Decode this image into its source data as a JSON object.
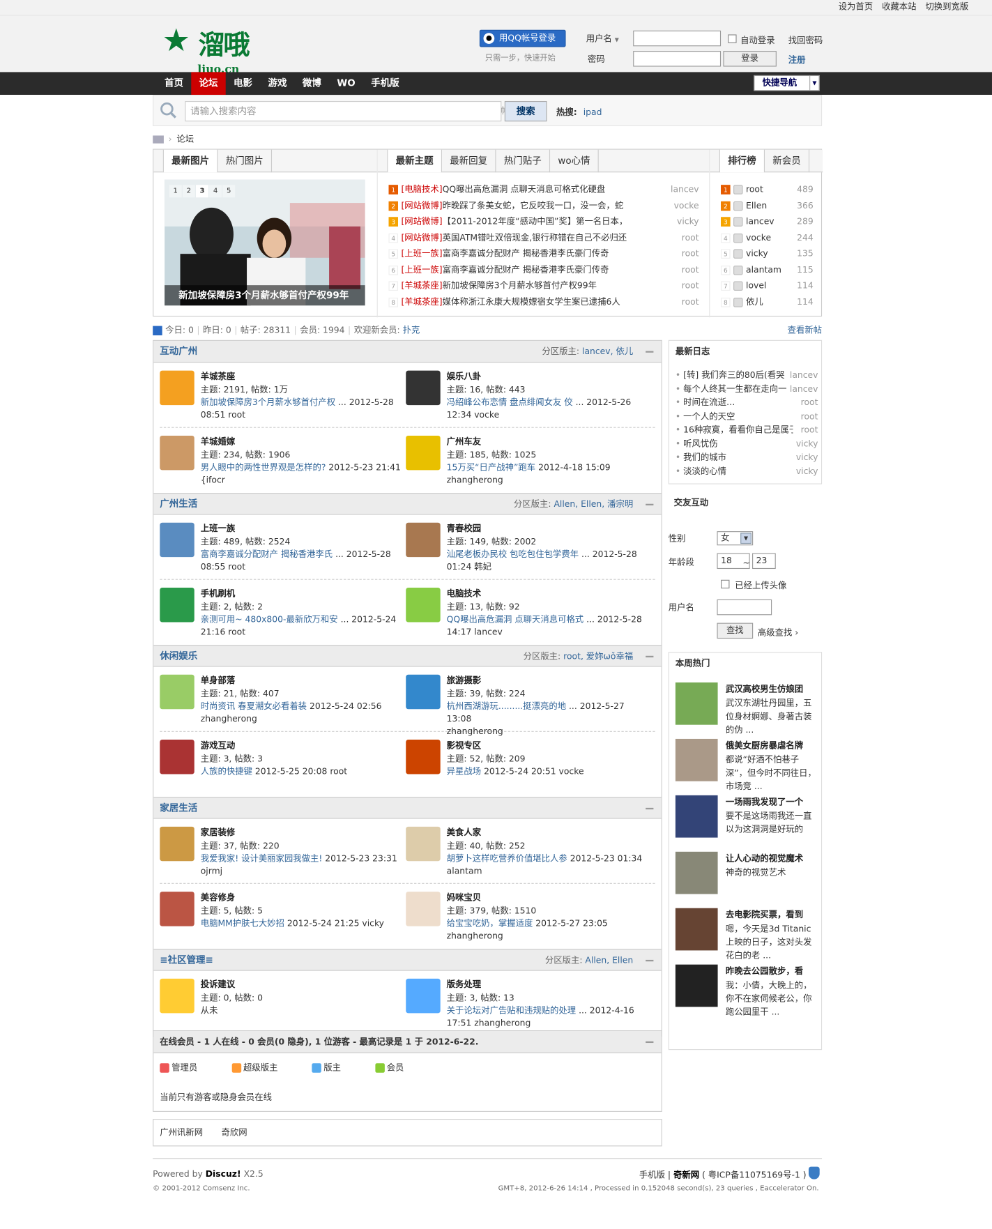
{
  "topbar": {
    "links": [
      "设为首页",
      "收藏本站",
      "切换到宽版"
    ]
  },
  "header": {
    "logo_text": "溜哦",
    "logo_domain": "liuo.cn",
    "qq_login": "用QQ帐号登录",
    "qq_sub": "只需一步，快速开始",
    "username_label": "用户名",
    "password_label": "密码",
    "auto_login": "自动登录",
    "forgot": "找回密码",
    "login_btn": "登录",
    "register": "注册"
  },
  "nav": {
    "items": [
      "首页",
      "论坛",
      "电影",
      "游戏",
      "微博",
      "WO",
      "手机版"
    ],
    "active": 1,
    "quick": "快捷导航"
  },
  "search": {
    "placeholder": "请输入搜索内容",
    "type": "帖子",
    "button": "搜索",
    "hot_label": "热搜:",
    "hot_term": "ipad"
  },
  "breadcrumb": {
    "current": "论坛"
  },
  "pic_box": {
    "tabs": [
      "最新图片",
      "热门图片"
    ],
    "pages": [
      "1",
      "2",
      "3",
      "4",
      "5"
    ],
    "active_page": 2,
    "caption": "新加坡保障房3个月薪水够首付产权99年"
  },
  "topic_box": {
    "tabs": [
      "最新主题",
      "最新回复",
      "热门贴子",
      "wo心情"
    ],
    "items": [
      {
        "n": "1",
        "cat": "[电脑技术]",
        "title": "QQ曝出高危漏洞 点聊天消息可格式化硬盘",
        "author": "lancev"
      },
      {
        "n": "2",
        "cat": "[网站微博]",
        "title": "昨晚踩了条美女蛇，它反咬我一口，没一会，蛇",
        "author": "vocke"
      },
      {
        "n": "3",
        "cat": "[网站微博]",
        "title": "【2011-2012年度“感动中国”奖】第一名日本，",
        "author": "vicky"
      },
      {
        "n": "4",
        "cat": "[网站微博]",
        "title": "英国ATM错吐双倍现金,银行称错在自己不必归还",
        "author": "root"
      },
      {
        "n": "5",
        "cat": "[上班一族]",
        "title": "富商李嘉诚分配财产 揭秘香港李氏豪门传奇",
        "author": "root"
      },
      {
        "n": "6",
        "cat": "[上班一族]",
        "title": "富商李嘉诚分配财产 揭秘香港李氏豪门传奇",
        "author": "root"
      },
      {
        "n": "7",
        "cat": "[羊城茶座]",
        "title": "新加坡保障房3个月薪水够首付产权99年",
        "author": "root"
      },
      {
        "n": "8",
        "cat": "[羊城茶座]",
        "title": "媒体称浙江永康大规模嫖宿女学生案已逮捕6人",
        "author": "root"
      }
    ]
  },
  "rank_box": {
    "tabs": [
      "排行榜",
      "新会员"
    ],
    "items": [
      {
        "n": "1",
        "name": "root",
        "count": "489"
      },
      {
        "n": "2",
        "name": "Ellen",
        "count": "366"
      },
      {
        "n": "3",
        "name": "lancev",
        "count": "289"
      },
      {
        "n": "4",
        "name": "vocke",
        "count": "244"
      },
      {
        "n": "5",
        "name": "vicky",
        "count": "135"
      },
      {
        "n": "6",
        "name": "alantam",
        "count": "115"
      },
      {
        "n": "7",
        "name": "lovel",
        "count": "114"
      },
      {
        "n": "8",
        "name": "依儿",
        "count": "114"
      }
    ]
  },
  "stats": {
    "today": "今日: 0",
    "yesterday": "昨日: 0",
    "posts": "帖子: 28311",
    "members": "会员: 1994",
    "welcome": "欢迎新会员:",
    "newest": "扑克",
    "new_posts": "查看新帖"
  },
  "sections": [
    {
      "title": "互动广州",
      "mods_label": "分区版主:",
      "mods": "lancev, 依儿",
      "forums": [
        {
          "name": "羊城茶座",
          "stats": "主题: 2191, 帖数: 1万",
          "last": "新加坡保障房3个月薪水够首付产权",
          "meta": "... 2012-5-28",
          "meta2": "08:51 root",
          "color": "#f4a020"
        },
        {
          "name": "娱乐八卦",
          "stats": "主题: 16, 帖数: 443",
          "last": "冯绍峰公布恋情 盘点绯闻女友 佼",
          "meta": "... 2012-5-26",
          "meta2": "12:34 vocke",
          "color": "#333"
        },
        {
          "name": "羊城婚嫁",
          "stats": "主题: 234, 帖数: 1906",
          "last": "男人眼中的两性世界观是怎样的?",
          "meta": "2012-5-23 21:41",
          "meta2": "{ifocr",
          "color": "#c96"
        },
        {
          "name": "广州车友",
          "stats": "主题: 185, 帖数: 1025",
          "last": "15万买“日产战神”跑车",
          "meta": "2012-4-18 15:09",
          "meta2": "zhangherong",
          "color": "#e8c000"
        }
      ]
    },
    {
      "title": "广州生活",
      "mods_label": "分区版主:",
      "mods": "Allen, Ellen, 潘宗明",
      "forums": [
        {
          "name": "上班一族",
          "stats": "主题: 489, 帖数: 2524",
          "last": "富商李嘉诚分配财产 揭秘香港李氏",
          "meta": "... 2012-5-28",
          "meta2": "08:55 root",
          "color": "#5a8cc0"
        },
        {
          "name": "青春校园",
          "stats": "主题: 149, 帖数: 2002",
          "last": "汕尾老板办民校 包吃包住包学费年",
          "meta": "... 2012-5-28",
          "meta2": "01:24 韩妃",
          "color": "#a87850"
        },
        {
          "name": "手机刷机",
          "stats": "主题: 2, 帖数: 2",
          "last": "亲测可用~ 480x800-最新欣万和安",
          "meta": "... 2012-5-24",
          "meta2": "21:16 root",
          "color": "#2a9a4a"
        },
        {
          "name": "电脑技术",
          "stats": "主题: 13, 帖数: 92",
          "last": "QQ曝出高危漏洞 点聊天消息可格式",
          "meta": "... 2012-5-28",
          "meta2": "14:17 lancev",
          "color": "#8c4"
        }
      ]
    },
    {
      "title": "休闲娱乐",
      "mods_label": "分区版主:",
      "mods": "root, 爱妳ωǒ幸福",
      "forums": [
        {
          "name": "单身部落",
          "stats": "主题: 21, 帖数: 407",
          "last": "时尚资讯 春夏潮女必看着装",
          "meta": "2012-5-24 02:56",
          "meta2": "zhangherong",
          "color": "#9c6"
        },
        {
          "name": "旅游摄影",
          "stats": "主题: 39, 帖数: 224",
          "last": "杭州西湖游玩.........挺漂亮的地",
          "meta": "... 2012-5-27 13:08",
          "meta2": "zhangherong",
          "color": "#38c"
        },
        {
          "name": "游戏互动",
          "stats": "主题: 3, 帖数: 3",
          "last": "人族的快捷键",
          "meta": "2012-5-25 20:08 root",
          "meta2": "",
          "color": "#a33"
        },
        {
          "name": "影视专区",
          "stats": "主题: 52, 帖数: 209",
          "last": "异星战场",
          "meta": "2012-5-24 20:51 vocke",
          "meta2": "",
          "color": "#c40"
        }
      ]
    },
    {
      "title": "家居生活",
      "mods_label": "",
      "mods": "",
      "forums": [
        {
          "name": "家居装修",
          "stats": "主题: 37, 帖数: 220",
          "last": "我爱我家! 设计美丽家园我做主!",
          "meta": "2012-5-23 23:31",
          "meta2": "ojrmj",
          "color": "#c94"
        },
        {
          "name": "美食人家",
          "stats": "主题: 40, 帖数: 252",
          "last": "胡萝卜这样吃营养价值堪比人参",
          "meta": "2012-5-23 01:34",
          "meta2": "alantam",
          "color": "#dca"
        },
        {
          "name": "美容修身",
          "stats": "主题: 5, 帖数: 5",
          "last": "电脑MM护肤七大妙招",
          "meta": "2012-5-24 21:25 vicky",
          "meta2": "",
          "color": "#b54"
        },
        {
          "name": "妈咪宝贝",
          "stats": "主题: 379, 帖数: 1510",
          "last": "给宝宝吃奶，掌握适度",
          "meta": "2012-5-27 23:05",
          "meta2": "zhangherong",
          "color": "#edc"
        }
      ]
    },
    {
      "title": "≡社区管理≡",
      "mods_label": "分区版主:",
      "mods": "Allen, Ellen",
      "forums": [
        {
          "name": "投诉建议",
          "stats": "主题: 0, 帖数: 0",
          "last": "",
          "meta": "从未",
          "meta2": "",
          "color": "#fc3"
        },
        {
          "name": "版务处理",
          "stats": "主题: 3, 帖数: 13",
          "last": "关于论坛对广告贴和违规贴的处理",
          "meta": "... 2012-4-16",
          "meta2": "17:51 zhangherong",
          "color": "#5af"
        }
      ]
    }
  ],
  "online": {
    "title": "在线会员 - 1 人在线 - 0 会员(0 隐身), 1 位游客 - 最高记录是 1 于 2012-6-22.",
    "legend": [
      "管理员",
      "超级版主",
      "版主",
      "会员"
    ],
    "note": "当前只有游客或隐身会员在线"
  },
  "links": [
    "广州讯新网",
    "奇欣网"
  ],
  "footer": {
    "powered": "Powered by",
    "brand": "Discuz!",
    "version": "X2.5",
    "copy": "© 2001-2012 Comsenz Inc.",
    "mobile": "手机版",
    "site": "奇新网",
    "icp": "( 粤ICP备11075169号-1 )",
    "gmt": "GMT+8, 2012-6-26 14:14 , Processed in 0.152048 second(s), 23 queries , Eaccelerator On."
  },
  "blog": {
    "title": "最新日志",
    "items": [
      {
        "t": "[转] 我们奔三的80后(看哭",
        "a": "lancev"
      },
      {
        "t": "每个人终其一生都在走向一",
        "a": "lancev"
      },
      {
        "t": "时间在流逝…",
        "a": "root"
      },
      {
        "t": "一个人的天空",
        "a": "root"
      },
      {
        "t": "16种寂寞，看看你自己是属于",
        "a": "root"
      },
      {
        "t": "听风忧伤",
        "a": "vicky"
      },
      {
        "t": "我们的城市",
        "a": "vicky"
      },
      {
        "t": "淡淡的心情",
        "a": "vicky"
      }
    ]
  },
  "friend": {
    "title": "交友互动",
    "gender_label": "性别",
    "gender": "女",
    "age_label": "年龄段",
    "age_from": "18",
    "age_sep": "~",
    "age_to": "23",
    "avatar": "已经上传头像",
    "user_label": "用户名",
    "find": "查找",
    "adv": "高级查找 ›"
  },
  "hot_week": {
    "title": "本周热门",
    "items": [
      {
        "t": "武汉高校男生仿娘团",
        "d": "武汉东湖牡丹园里，五位身材婀娜、身著古装的伪 ...",
        "color": "#7a5"
      },
      {
        "t": "俄美女厨房暴虐名牌",
        "d": "都说“好酒不怕巷子深”，但今时不同往日，市场竞 ...",
        "color": "#a98"
      },
      {
        "t": "一场雨我发现了一个",
        "d": "要不是这场雨我还一直以为这洞洞是好玩的",
        "color": "#347"
      },
      {
        "t": "让人心动的视觉魔术",
        "d": "神奇的视觉艺术",
        "color": "#887"
      },
      {
        "t": "去电影院买票，看到",
        "d": "嗯，今天是3d Titanic上映的日子，这对头发花白的老 ...",
        "color": "#643"
      },
      {
        "t": "昨晚去公园散步，看",
        "d": "我：小倩，大晚上的，你不在家伺候老公，你跑公园里干 ...",
        "color": "#222"
      }
    ]
  }
}
